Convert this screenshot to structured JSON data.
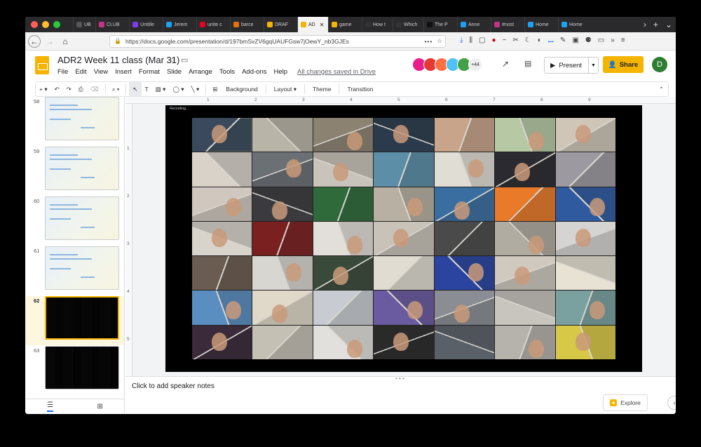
{
  "browser": {
    "tabs": [
      {
        "label": "UB",
        "fav": "#555"
      },
      {
        "label": "CLUB",
        "fav": "#c13584"
      },
      {
        "label": "Untitle",
        "fav": "#7b3fe4"
      },
      {
        "label": "Jerem",
        "fav": "#1da1f2"
      },
      {
        "label": "unite c",
        "fav": "#e60023"
      },
      {
        "label": "barce",
        "fav": "#e8710a"
      },
      {
        "label": "DRAF",
        "fav": "#f4b400"
      },
      {
        "label": "AD",
        "fav": "#f4b400"
      },
      {
        "label": "game",
        "fav": "#f4b400"
      },
      {
        "label": "How t",
        "fav": "#333"
      },
      {
        "label": "Which",
        "fav": "#333"
      },
      {
        "label": "The P",
        "fav": "#111"
      },
      {
        "label": "Anne",
        "fav": "#1da1f2"
      },
      {
        "label": "#nost",
        "fav": "#c13584"
      },
      {
        "label": "Home",
        "fav": "#1da1f2"
      },
      {
        "label": "Home",
        "fav": "#1da1f2"
      }
    ],
    "active_tab_index": 7,
    "url": "https://docs.google.com/presentation/d/197bmSvZV6gqUAUFGsw7jOewY_nb3GJEs"
  },
  "doc": {
    "title": "ADR2 Week 11 class (Mar 31)",
    "menu": [
      "File",
      "Edit",
      "View",
      "Insert",
      "Format",
      "Slide",
      "Arrange",
      "Tools",
      "Add-ons",
      "Help"
    ],
    "saved_status": "All changes saved in Drive",
    "collaborator_colors": [
      "#e91e8c",
      "#e53935",
      "#ff7043",
      "#4fc3f7",
      "#43a047"
    ],
    "collaborator_extra": "+44",
    "present_label": "Present",
    "share_label": "Share",
    "user_initial": "D"
  },
  "toolbar": {
    "background": "Background",
    "layout": "Layout",
    "theme": "Theme",
    "transition": "Transition"
  },
  "filmstrip": {
    "slides": [
      {
        "num": "58",
        "kind": "light"
      },
      {
        "num": "59",
        "kind": "light"
      },
      {
        "num": "60",
        "kind": "light"
      },
      {
        "num": "61",
        "kind": "light"
      },
      {
        "num": "62",
        "kind": "dark",
        "selected": true
      },
      {
        "num": "63",
        "kind": "dark"
      }
    ]
  },
  "ruler": {
    "top": [
      "1",
      "2",
      "3",
      "4",
      "5",
      "6",
      "7",
      "8",
      "9"
    ],
    "left": [
      "1",
      "2",
      "3",
      "4",
      "5"
    ]
  },
  "slide": {
    "recording_label": "Recording...",
    "tile_colors": [
      [
        "#3a4a5c",
        "#b9b4a8",
        "#8c8272",
        "#2b3b4d",
        "#c7a48a",
        "#b7c9a4",
        "#cfc6b8"
      ],
      [
        "#d9d2c9",
        "#6b7075",
        "#c9c4bb",
        "#5c8ea8",
        "#e0ddd4",
        "#2a2a30",
        "#9c9aa0"
      ],
      [
        "#d0c8be",
        "#3b3b3f",
        "#2f6b3a",
        "#b8b0a2",
        "#3a6ea0",
        "#e87a2a",
        "#2f5aa0"
      ],
      [
        "#d8d4cc",
        "#7a2020",
        "#e2dfda",
        "#c8c2b8",
        "#4a4a4a",
        "#b0aca2",
        "#d6d4d2"
      ],
      [
        "#6a5c50",
        "#d8d6d0",
        "#3a4a3a",
        "#e0dcd2",
        "#2a44a0",
        "#cfc9bf",
        "#e8e2d4"
      ],
      [
        "#5a8ec0",
        "#e0d8c8",
        "#c8ccd2",
        "#6a5aa0",
        "#8a8e94",
        "#c8c4be",
        "#7aa0a0"
      ],
      [
        "#3a2a3a",
        "#c4c0b4",
        "#e2e0dc",
        "#2a2a2a",
        "#5a6068",
        "#b6b2ac",
        "#d8c848"
      ]
    ]
  },
  "notes": {
    "placeholder": "Click to add speaker notes",
    "explore_label": "Explore"
  }
}
